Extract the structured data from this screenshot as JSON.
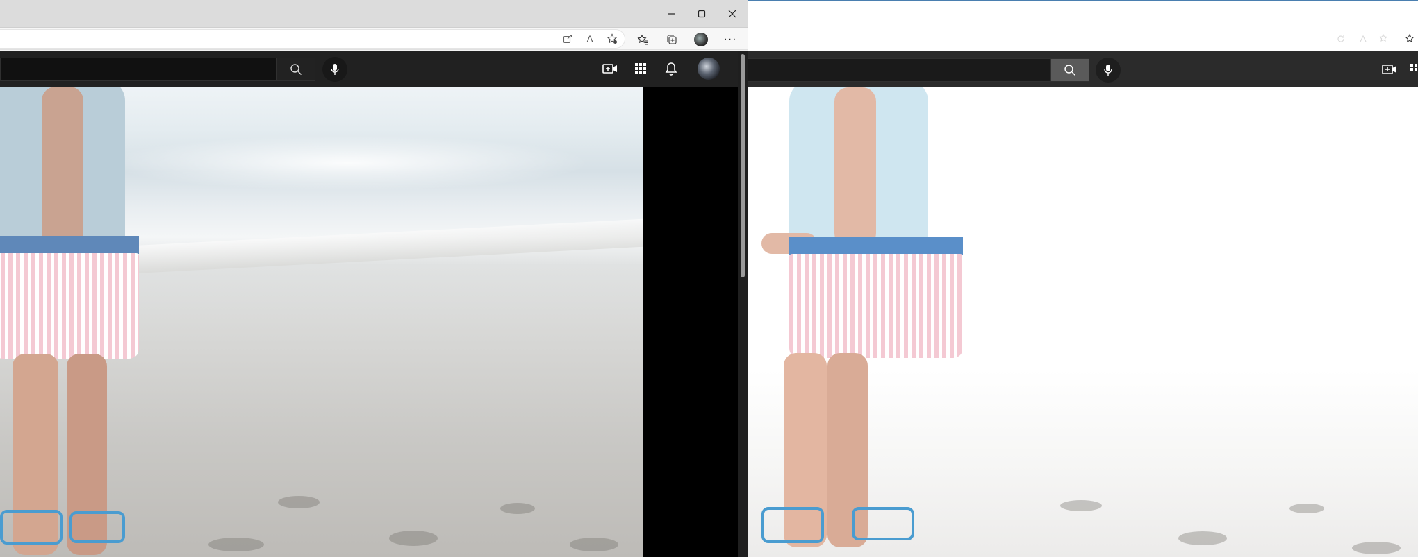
{
  "left_window": {
    "caption": {
      "minimize": "—",
      "maximize": "☐",
      "close": "✕"
    },
    "toolbar_icons": [
      "open-external-icon",
      "read-aloud-icon",
      "add-favorite-icon",
      "favorites-icon",
      "collections-icon",
      "profile-icon",
      "more-icon"
    ],
    "read_aloud_glyph": "A",
    "more_glyph": "···"
  },
  "site_header": {
    "icons": [
      "search-icon",
      "microphone-icon",
      "create-video-icon",
      "apps-grid-icon",
      "notifications-icon",
      "avatar"
    ]
  },
  "colors": {
    "header_bg": "#212121",
    "letterbox": "#000000",
    "titlebar": "#dcdcdc",
    "right_window_border": "#4a7fb0"
  }
}
